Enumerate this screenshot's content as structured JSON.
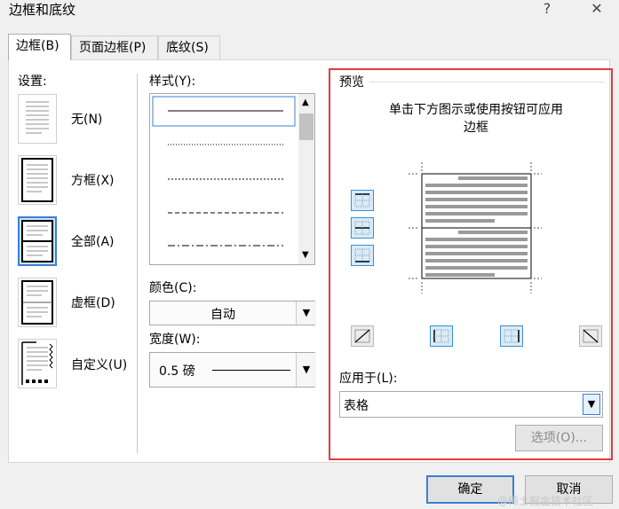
{
  "window": {
    "title": "边框和底纹",
    "help": "?",
    "close": "✕"
  },
  "tabs": [
    {
      "label": "边框(B)"
    },
    {
      "label": "页面边框(P)"
    },
    {
      "label": "底纹(S)"
    }
  ],
  "settings": {
    "heading": "设置:",
    "items": [
      {
        "label": "无(N)",
        "icon": "none-border-icon"
      },
      {
        "label": "方框(X)",
        "icon": "box-border-icon"
      },
      {
        "label": "全部(A)",
        "icon": "all-borders-icon"
      },
      {
        "label": "虚框(D)",
        "icon": "grid-border-icon"
      },
      {
        "label": "自定义(U)",
        "icon": "custom-border-icon"
      }
    ],
    "selected": "全部(A)"
  },
  "style": {
    "heading": "样式(Y):"
  },
  "color": {
    "heading": "颜色(C):",
    "value": "自动"
  },
  "width": {
    "heading": "宽度(W):",
    "value": "0.5 磅"
  },
  "preview": {
    "heading": "预览",
    "hint_line1": "单击下方图示或使用按钮可应用",
    "hint_line2": "边框"
  },
  "apply": {
    "heading": "应用于(L):",
    "value": "表格"
  },
  "buttons": {
    "options": "选项(O)...",
    "ok": "确定",
    "cancel": "取消"
  },
  "watermark": "@稀土掘金技术社区"
}
